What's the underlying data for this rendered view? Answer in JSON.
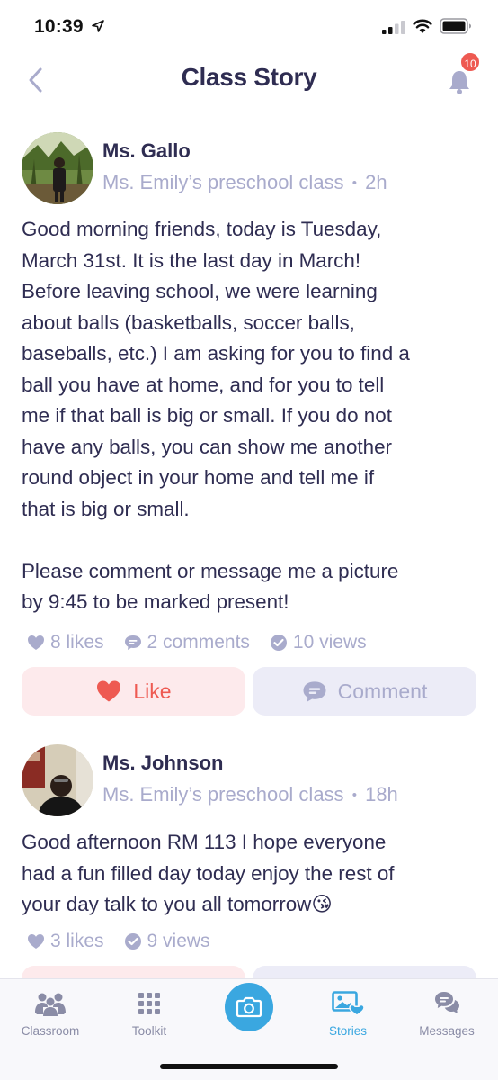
{
  "status_bar": {
    "time": "10:39"
  },
  "nav": {
    "title": "Class Story",
    "notification_count": "10"
  },
  "posts": [
    {
      "author": "Ms. Gallo",
      "class_name": "Ms. Emily’s preschool class",
      "separator": "•",
      "time_ago": "2h",
      "body": "Good morning friends, today is Tuesday,\nMarch 31st. It is the last day in March!\nBefore leaving school, we were learning\nabout balls (basketballs, soccer balls,\nbaseballs, etc.) I am asking for you to find a\nball you have at home, and for you to tell\nme if that ball is big or small. If you do not\nhave any balls, you can show me another\nround object in your home and tell me if\nthat is big or small.\n\nPlease comment or message me a picture\nby 9:45 to be marked present!",
      "likes": "8 likes",
      "comments": "2 comments",
      "views": "10 views",
      "like_label": "Like",
      "comment_label": "Comment"
    },
    {
      "author": "Ms. Johnson",
      "class_name": "Ms. Emily’s preschool class",
      "separator": "•",
      "time_ago": "18h",
      "body": "Good afternoon RM 113 I hope everyone\nhad a fun filled day today enjoy the rest of\nyour day talk to you all tomorrow😘",
      "likes": "3 likes",
      "views": "9 views"
    }
  ],
  "tabbar": {
    "items": [
      {
        "label": "Classroom",
        "icon": "classroom-icon"
      },
      {
        "label": "Toolkit",
        "icon": "toolkit-icon"
      },
      {
        "label": "",
        "icon": "camera-icon"
      },
      {
        "label": "Stories",
        "icon": "stories-icon",
        "active": true
      },
      {
        "label": "Messages",
        "icon": "messages-icon"
      }
    ]
  },
  "colors": {
    "accent_blue": "#3aa7e0",
    "title_navy": "#2f2d52",
    "muted": "#a9abcc",
    "like_red": "#ee5a52",
    "like_bg": "#fdeaec",
    "comment_bg": "#ececf7"
  }
}
